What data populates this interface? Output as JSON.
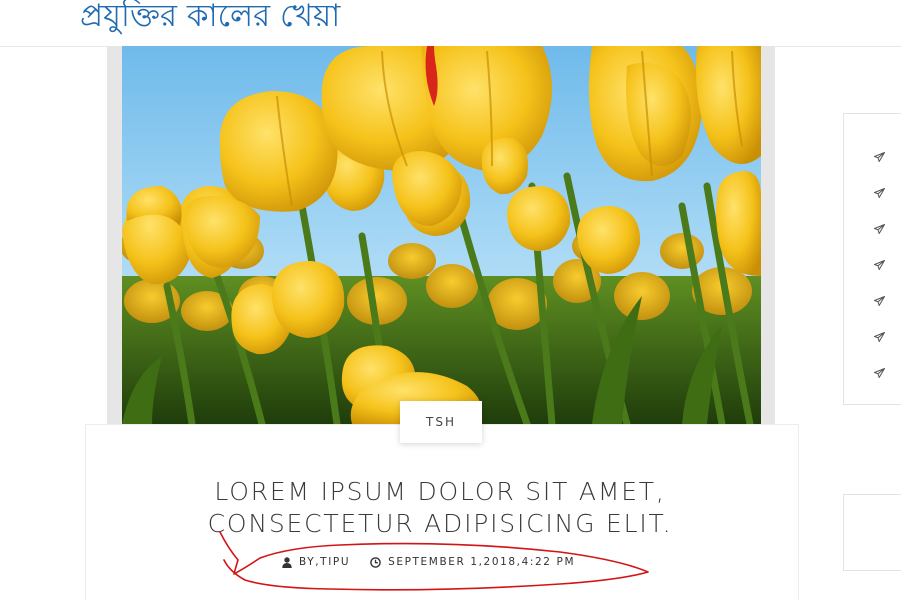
{
  "header": {
    "site_title": "প্রযুক্তির কালের খেয়া"
  },
  "post": {
    "image_alt": "Yellow tulips against a blue sky",
    "category": "TSH",
    "title_line1": "LOREM IPSUM DOLOR SIT AMET,",
    "title_line2": "CONSECTETUR ADIPISICING ELIT.",
    "author": "BY,TIPU",
    "date": "SEPTEMBER 1,2018,4:22 PM"
  },
  "colors": {
    "site_title": "#1f6ab0",
    "annotation_ink": "#d21414",
    "sky": "#8fcdf1",
    "tulip": "#f2bd12",
    "stem": "#4b7a1a"
  },
  "icons": {
    "author": "user-icon",
    "date": "clock-icon",
    "sidebar_item": "paper-plane-icon"
  }
}
